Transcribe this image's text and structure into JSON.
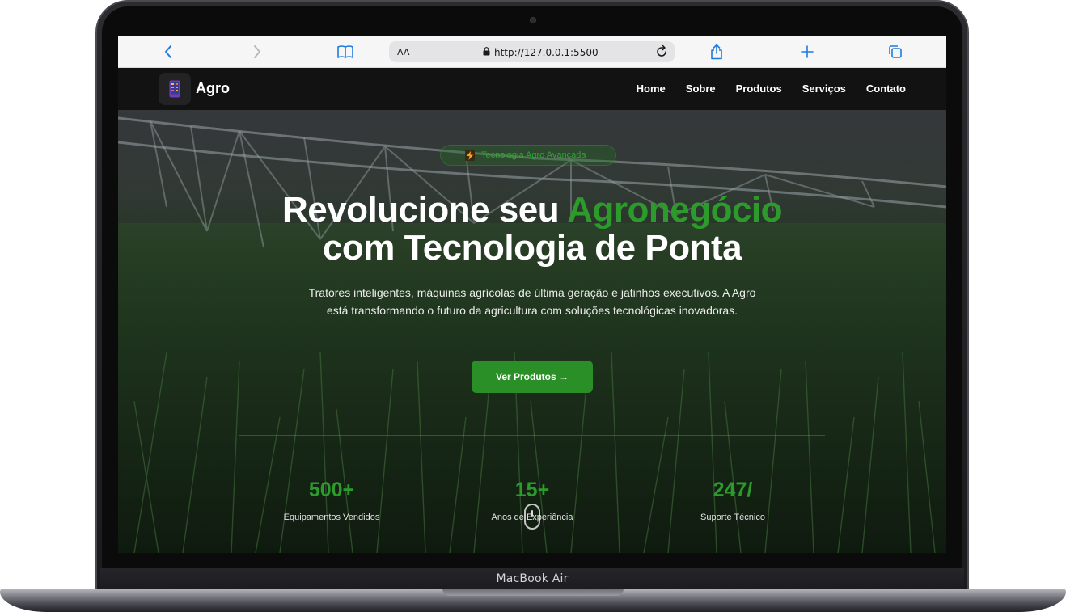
{
  "device": {
    "label": "MacBook Air"
  },
  "browser": {
    "text_size_label": "AA",
    "url": "http://127.0.0.1:5500",
    "icons": [
      "back-icon",
      "forward-icon",
      "bookmarks-icon",
      "lock-icon",
      "reload-icon",
      "share-icon",
      "new-tab-icon",
      "tabs-icon"
    ]
  },
  "site": {
    "logo_text": "Agro",
    "nav": [
      {
        "label": "Home"
      },
      {
        "label": "Sobre"
      },
      {
        "label": "Produtos"
      },
      {
        "label": "Serviços"
      },
      {
        "label": "Contato"
      }
    ]
  },
  "hero": {
    "badge": "Tecnologia Agro Avançada",
    "headline_part1": "Revolucione seu ",
    "headline_accent": "Agronegócio",
    "headline_line2": "com Tecnologia de Ponta",
    "subtitle": "Tratores inteligentes, máquinas agrícolas de última geração e jatinhos executivos. A Agro está transformando o futuro da agricultura com soluções tecnológicas inovadoras.",
    "cta_label": "Ver Produtos →",
    "stats": [
      {
        "value": "500+",
        "label": "Equipamentos Vendidos"
      },
      {
        "value": "15+",
        "label": "Anos de Experiência"
      },
      {
        "value": "247/",
        "label": "Suporte Técnico"
      }
    ]
  },
  "colors": {
    "accent_green": "#2c9b2c",
    "nav_background": "#121212",
    "cta_background": "#2a8f27"
  }
}
